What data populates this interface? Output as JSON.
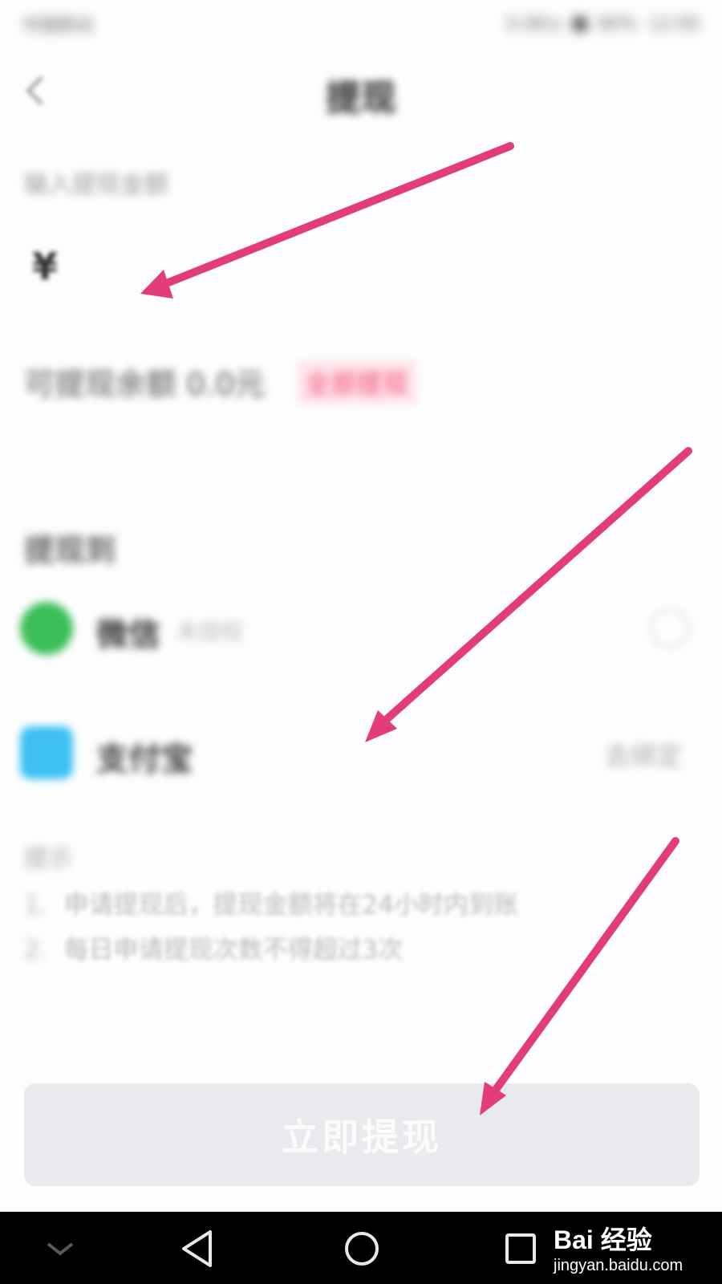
{
  "status_bar": {
    "carrier": "中国移动",
    "right_text": "0.0K/s",
    "battery": "80%",
    "time": "12:00"
  },
  "nav": {
    "title": "提现"
  },
  "amount": {
    "label": "输入提现金额",
    "currency_symbol": "¥"
  },
  "balance": {
    "text": "可提现余额 0.0元",
    "withdraw_all_label": "全部提现"
  },
  "methods": {
    "section_title": "提现到",
    "items": [
      {
        "name": "微信",
        "sub": "未授权",
        "action": "",
        "color": "#3cbf58"
      },
      {
        "name": "支付宝",
        "sub": "",
        "action": "去绑定",
        "color": "#3cc0f2"
      }
    ]
  },
  "tips": {
    "title": "提示",
    "items": [
      {
        "num": "1.",
        "text": "申请提现后，提现金额将在24小时内到账"
      },
      {
        "num": "2.",
        "text": "每日申请提现次数不得超过3次"
      }
    ]
  },
  "submit": {
    "label": "立即提现"
  },
  "annotation_color": "#e23d7a",
  "watermark": {
    "brand": "Bai 经验",
    "url": "jingyan.baidu.com"
  }
}
